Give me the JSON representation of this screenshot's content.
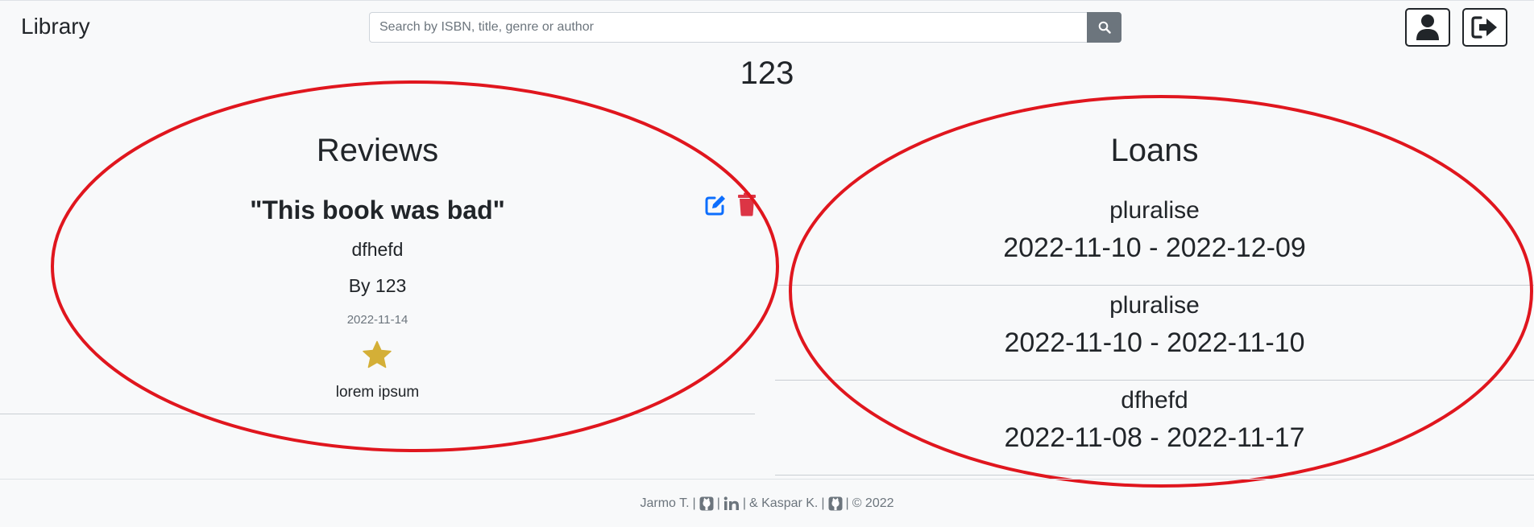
{
  "header": {
    "brand": "Library",
    "search": {
      "placeholder": "Search by ISBN, title, genre or author",
      "value": ""
    },
    "search_icon": "search-icon",
    "profile_icon": "user-icon",
    "logout_icon": "logout-icon"
  },
  "book": {
    "title": "123"
  },
  "reviews": {
    "title": "Reviews",
    "items": [
      {
        "heading": "\"This book was bad\"",
        "alias": "dfhefd",
        "by": "By 123",
        "date": "2022-11-14",
        "rating": 1,
        "text": "lorem ipsum",
        "edit_icon": "edit-icon",
        "delete_icon": "trash-icon"
      }
    ]
  },
  "loans": {
    "title": "Loans",
    "items": [
      {
        "user": "pluralise",
        "dates": "2022-11-10 - 2022-12-09"
      },
      {
        "user": "pluralise",
        "dates": "2022-11-10 - 2022-11-10"
      },
      {
        "user": "dfhefd",
        "dates": "2022-11-08 - 2022-11-17"
      }
    ]
  },
  "footer": {
    "author1": "Jarmo T.",
    "sep1": "|",
    "sep2": "|",
    "sep3": "|",
    "author2": "& Kaspar K.",
    "sep4": "|",
    "sep5": "|",
    "copyright": "© 2022"
  },
  "colors": {
    "accent_blue": "#0d6efd",
    "danger_red": "#dc3545",
    "star_gold": "#d4af37",
    "annotation_red": "#e0161e",
    "button_gray": "#6c757d"
  }
}
